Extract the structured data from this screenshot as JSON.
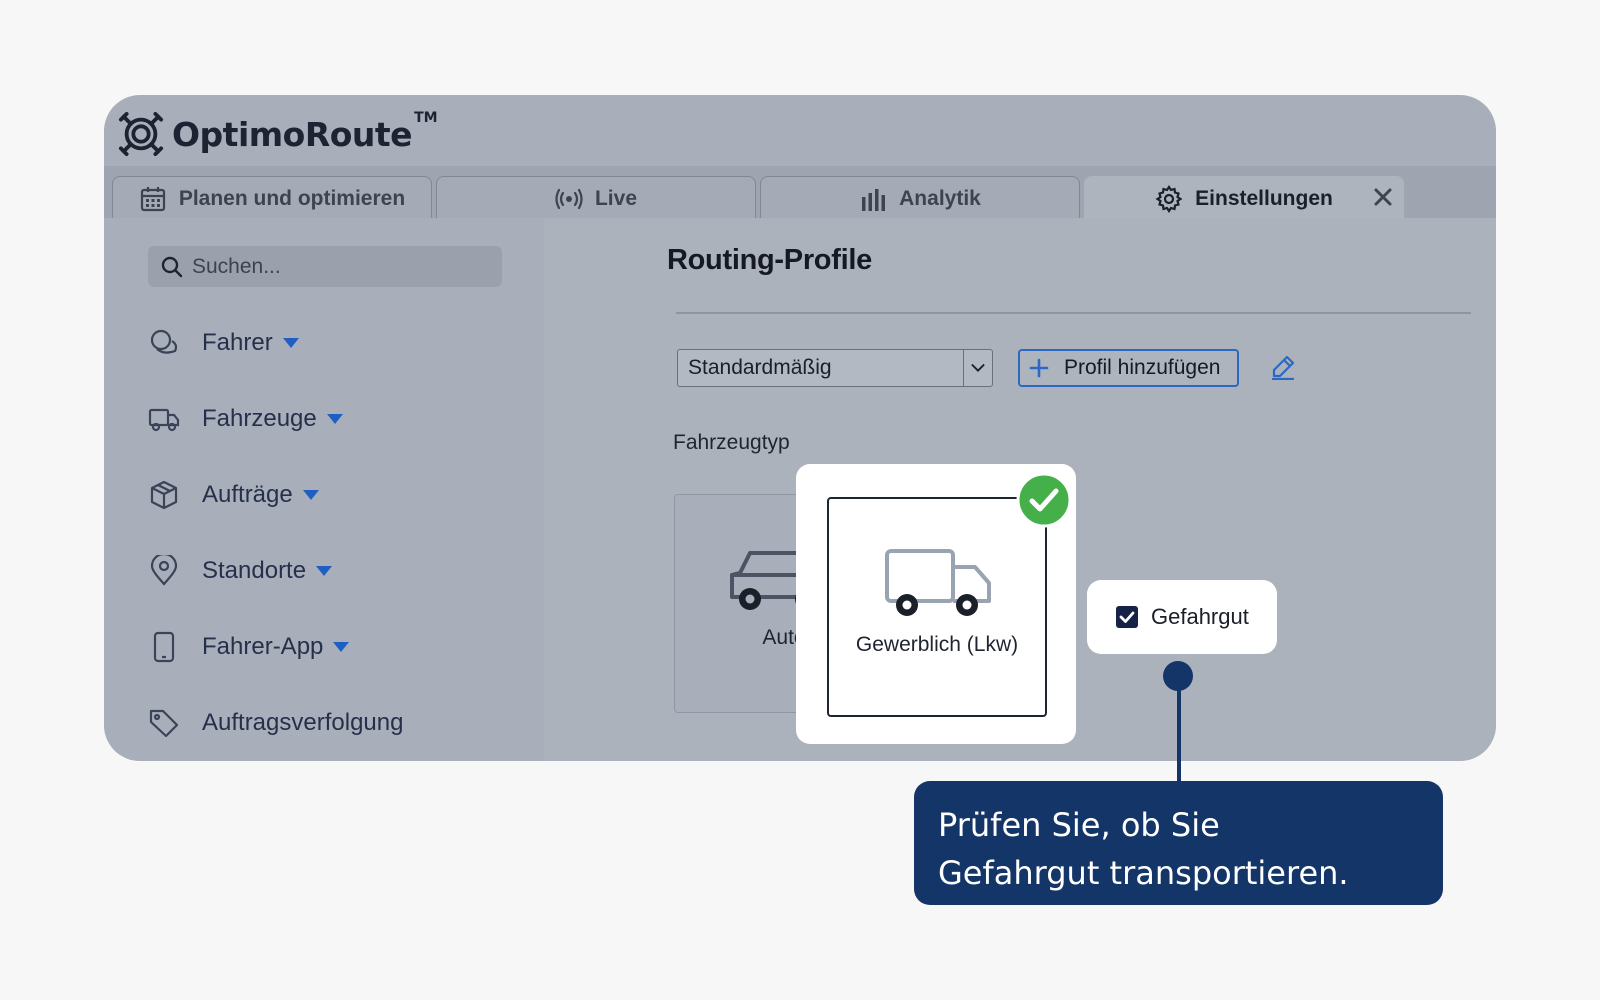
{
  "app": {
    "name": "OptimoRoute",
    "trademark": "TM"
  },
  "tabs": [
    {
      "label": "Planen und optimieren",
      "icon": "calendar-icon"
    },
    {
      "label": "Live",
      "icon": "broadcast-icon"
    },
    {
      "label": "Analytik",
      "icon": "bar-chart-icon"
    },
    {
      "label": "Einstellungen",
      "icon": "gear-icon",
      "active": true
    }
  ],
  "search": {
    "placeholder": "Suchen..."
  },
  "sidebar": {
    "items": [
      {
        "label": "Fahrer",
        "icon": "driver-icon",
        "expandable": true
      },
      {
        "label": "Fahrzeuge",
        "icon": "truck-icon",
        "expandable": true
      },
      {
        "label": "Aufträge",
        "icon": "package-icon",
        "expandable": true
      },
      {
        "label": "Standorte",
        "icon": "location-pin-icon",
        "expandable": true
      },
      {
        "label": "Fahrer-App",
        "icon": "phone-icon",
        "expandable": true
      },
      {
        "label": "Auftragsverfolgung",
        "icon": "tag-icon",
        "expandable": false
      }
    ]
  },
  "main": {
    "title": "Routing-Profile",
    "profile_select": {
      "value": "Standardmäßig"
    },
    "add_profile_label": "Profil hinzufügen",
    "vehicle_type_label": "Fahrzeugtyp",
    "vehicle_types": [
      {
        "label": "Auto",
        "icon": "car-icon",
        "selected": false
      },
      {
        "label": "Gewerblich (Lkw)",
        "icon": "truck-icon",
        "selected": true
      }
    ],
    "hazardous": {
      "label": "Gefahrgut",
      "checked": true
    }
  },
  "callout": {
    "line1": "Prüfen Sie, ob Sie",
    "line2": "Gefahrgut transportieren."
  },
  "colors": {
    "accent_blue": "#2a68c4",
    "callout_navy": "#143567",
    "check_green": "#45b04a",
    "dim_overlay": "#a9afba"
  }
}
